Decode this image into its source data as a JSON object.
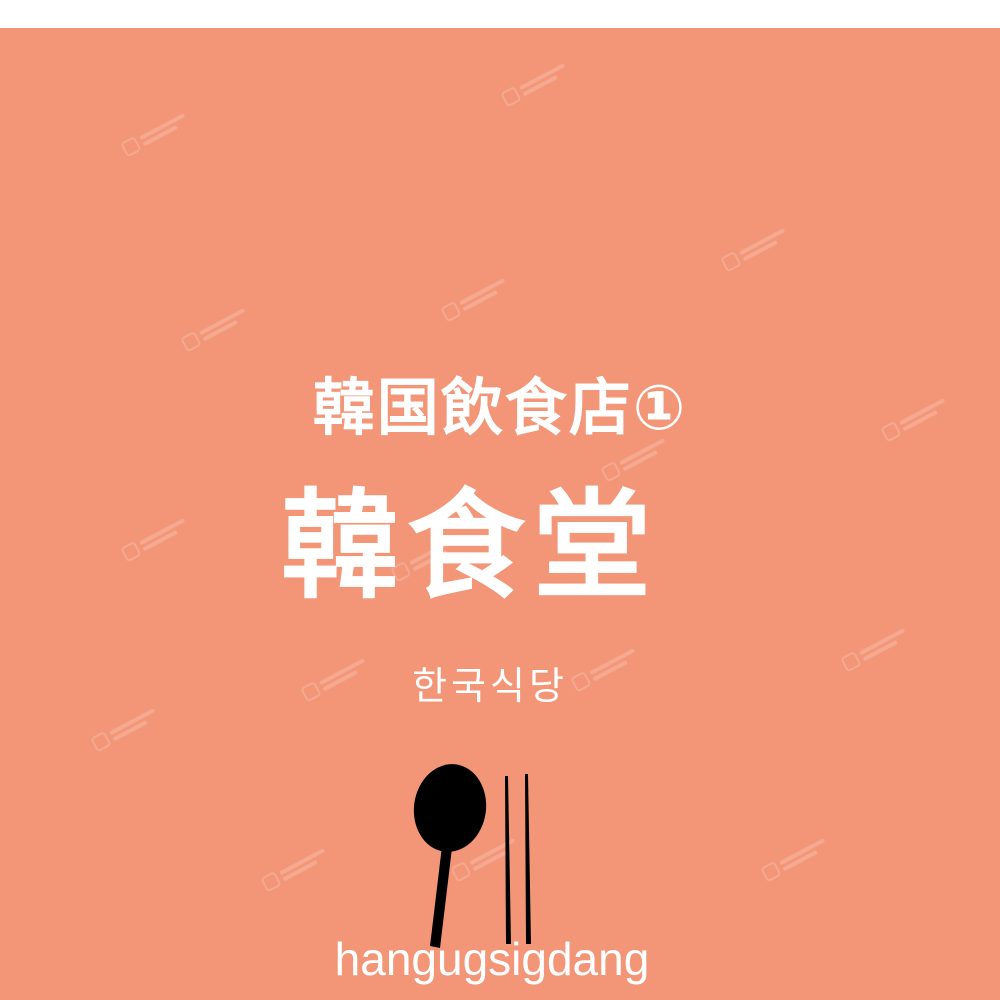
{
  "subtitle": "韓国飲食店①",
  "main_title": "韓食堂",
  "hangul": "한국식당",
  "romanization": "hangugsigdang",
  "icon": "spoon-and-chopsticks-icon",
  "colors": {
    "background": "#f39678",
    "text": "#ffffff",
    "icon": "#000000"
  }
}
